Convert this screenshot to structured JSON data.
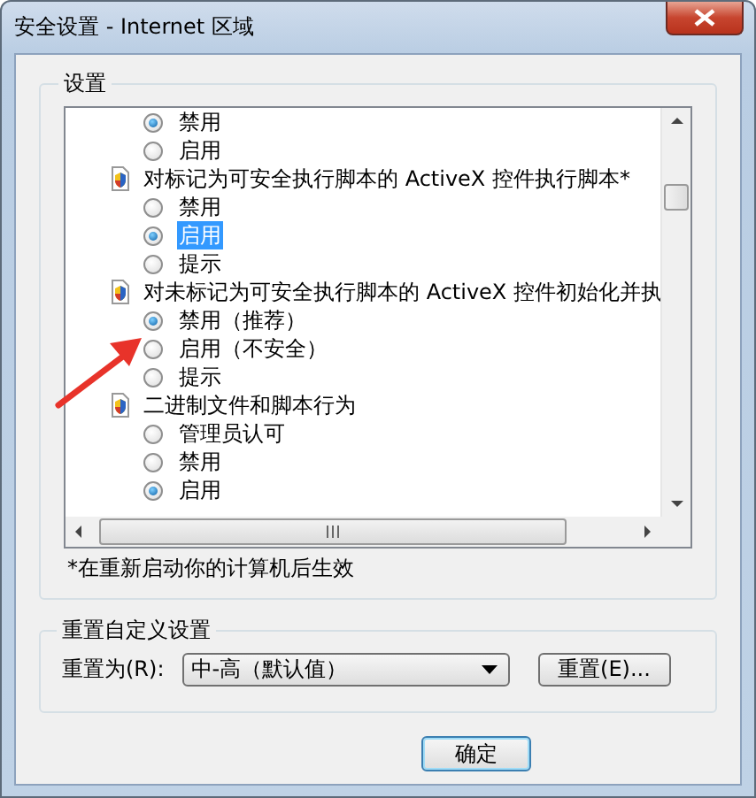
{
  "window": {
    "title": "安全设置 - Internet 区域"
  },
  "settings": {
    "title": "设置",
    "items": [
      {
        "kind": "radio",
        "label": "禁用",
        "selected": true,
        "focused": false
      },
      {
        "kind": "radio",
        "label": "启用",
        "selected": false,
        "focused": false
      },
      {
        "kind": "header",
        "label": "对标记为可安全执行脚本的 ActiveX 控件执行脚本*"
      },
      {
        "kind": "radio",
        "label": "禁用",
        "selected": false,
        "focused": false
      },
      {
        "kind": "radio",
        "label": "启用",
        "selected": true,
        "focused": true
      },
      {
        "kind": "radio",
        "label": "提示",
        "selected": false,
        "focused": false
      },
      {
        "kind": "header",
        "label": "对未标记为可安全执行脚本的 ActiveX 控件初始化并执"
      },
      {
        "kind": "radio",
        "label": "禁用（推荐）",
        "selected": true,
        "focused": false
      },
      {
        "kind": "radio",
        "label": "启用（不安全）",
        "selected": false,
        "focused": false
      },
      {
        "kind": "radio",
        "label": "提示",
        "selected": false,
        "focused": false
      },
      {
        "kind": "header",
        "label": "二进制文件和脚本行为"
      },
      {
        "kind": "radio",
        "label": "管理员认可",
        "selected": false,
        "focused": false
      },
      {
        "kind": "radio",
        "label": "禁用",
        "selected": false,
        "focused": false
      },
      {
        "kind": "radio",
        "label": "启用",
        "selected": true,
        "focused": false
      }
    ],
    "note": "*在重新启动你的计算机后生效"
  },
  "reset": {
    "title": "重置自定义设置",
    "label": "重置为(R):",
    "value": "中-高（默认值）",
    "button": "重置(E)..."
  },
  "buttons": [
    "确定"
  ]
}
